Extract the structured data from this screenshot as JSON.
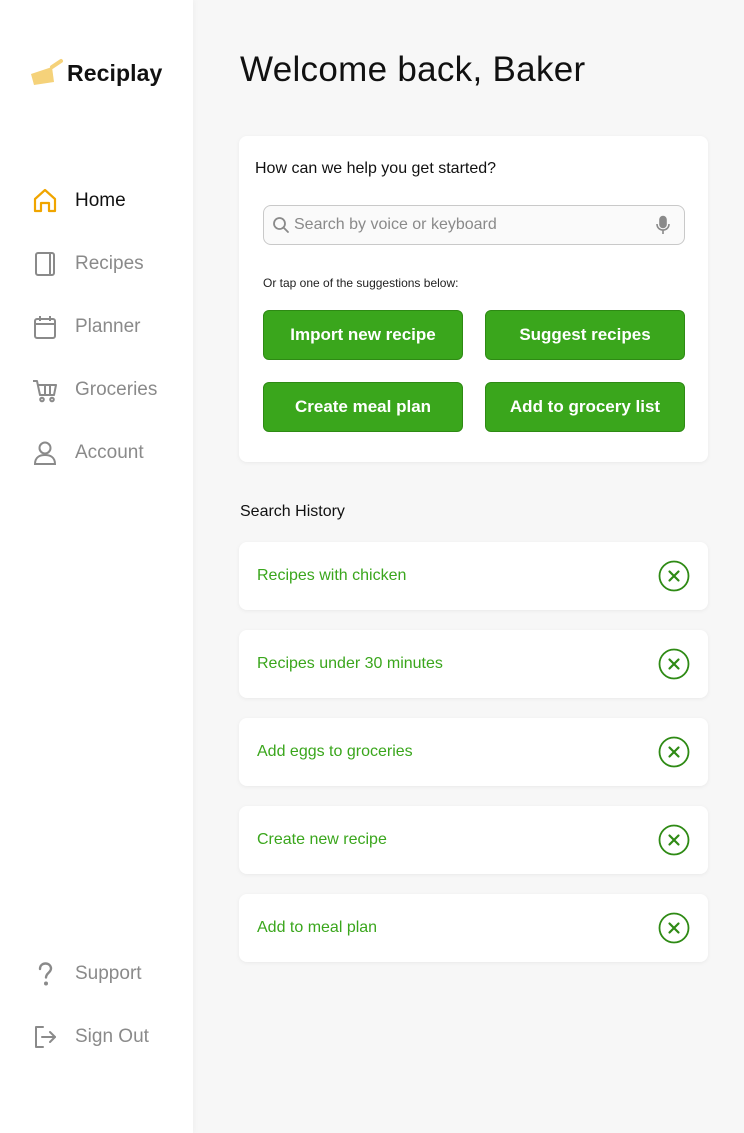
{
  "app": {
    "name": "Reciplay"
  },
  "colors": {
    "accent": "#3aa61c",
    "nav_active_icon": "#f0a500",
    "logo": "#f5d27a"
  },
  "sidebar": {
    "items": [
      {
        "label": "Home",
        "icon": "home-icon",
        "active": true
      },
      {
        "label": "Recipes",
        "icon": "book-icon",
        "active": false
      },
      {
        "label": "Planner",
        "icon": "calendar-icon",
        "active": false
      },
      {
        "label": "Groceries",
        "icon": "cart-icon",
        "active": false
      },
      {
        "label": "Account",
        "icon": "user-icon",
        "active": false
      }
    ],
    "bottom": [
      {
        "label": "Support",
        "icon": "help-icon"
      },
      {
        "label": "Sign Out",
        "icon": "sign-out-icon"
      }
    ]
  },
  "main": {
    "welcome": "Welcome back, Baker",
    "help": {
      "title": "How can we help you get started?",
      "search_placeholder": "Search by voice or keyboard",
      "hint": "Or tap one of the suggestions below:",
      "buttons": [
        "Import new recipe",
        "Suggest recipes",
        "Create meal plan",
        "Add to grocery list"
      ]
    },
    "history": {
      "title": "Search History",
      "items": [
        "Recipes with chicken",
        "Recipes under 30 minutes",
        "Add eggs to groceries",
        "Create new recipe",
        "Add to meal plan"
      ]
    }
  }
}
